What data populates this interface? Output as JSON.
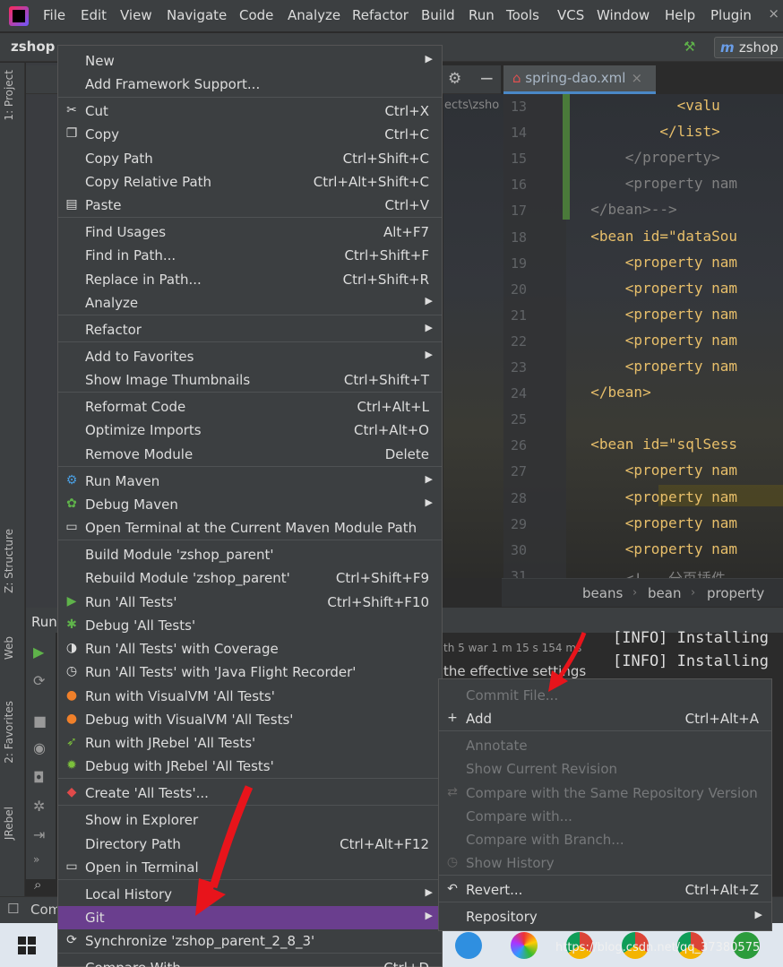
{
  "menubar": {
    "items": [
      "File",
      "Edit",
      "View",
      "Navigate",
      "Code",
      "Analyze",
      "Refactor",
      "Build",
      "Run",
      "Tools",
      "VCS",
      "Window",
      "Help",
      "Plugin"
    ],
    "close": "×"
  },
  "navbar": {
    "project": "zshop",
    "run_config": "zshop"
  },
  "left_stripe": {
    "tabs": [
      "1: Project",
      "Z: Structure",
      "Web",
      "2: Favorites",
      "JRebel"
    ]
  },
  "editor": {
    "tab_label": "spring-dao.xml",
    "tab_close": "×",
    "path_hint": "ects\\zsho",
    "lines": [
      {
        "n": "13",
        "text": "            <valu",
        "kind": "tag"
      },
      {
        "n": "14",
        "text": "          </list>",
        "kind": "tag"
      },
      {
        "n": "15",
        "text": "      </property>",
        "kind": "cm"
      },
      {
        "n": "16",
        "text": "      <property nam",
        "kind": "cm"
      },
      {
        "n": "17",
        "text": "  </bean>-->",
        "kind": "cm"
      },
      {
        "n": "18",
        "text": "  <bean id=\"dataSou",
        "kind": "tag"
      },
      {
        "n": "19",
        "text": "      <property nam",
        "kind": "tag"
      },
      {
        "n": "20",
        "text": "      <property nam",
        "kind": "tag"
      },
      {
        "n": "21",
        "text": "      <property nam",
        "kind": "tag"
      },
      {
        "n": "22",
        "text": "      <property nam",
        "kind": "tag"
      },
      {
        "n": "23",
        "text": "      <property nam",
        "kind": "tag"
      },
      {
        "n": "24",
        "text": "  </bean>",
        "kind": "tag"
      },
      {
        "n": "25",
        "text": "",
        "kind": "tag"
      },
      {
        "n": "26",
        "text": "  <bean id=\"sqlSess",
        "kind": "tag"
      },
      {
        "n": "27",
        "text": "      <property nam",
        "kind": "tag"
      },
      {
        "n": "28",
        "text": "      <property nam",
        "kind": "tag"
      },
      {
        "n": "29",
        "text": "      <property nam",
        "kind": "tag"
      },
      {
        "n": "30",
        "text": "      <property nam",
        "kind": "tag"
      },
      {
        "n": "31",
        "text": "      <!-- 分页插件",
        "kind": "cm"
      }
    ],
    "breadcrumbs": [
      "beans",
      "bean",
      "property"
    ]
  },
  "run_panel": {
    "label": "Run",
    "summary1": "th 5 war 1 m 15 s 154 ms",
    "summary2": "the effective settings",
    "console": [
      "[INFO] Installing",
      "[INFO] Installing"
    ]
  },
  "bottom": {
    "label": "Com"
  },
  "context_menu": {
    "items": [
      {
        "label": "New",
        "shortcut": "",
        "submenu": true,
        "icon": ""
      },
      {
        "label": "Add Framework Support...",
        "shortcut": "",
        "submenu": false,
        "icon": ""
      },
      {
        "label": "Cut",
        "shortcut": "Ctrl+X",
        "submenu": false,
        "icon": "scissors-icon"
      },
      {
        "label": "Copy",
        "shortcut": "Ctrl+C",
        "submenu": false,
        "icon": "copy-icon"
      },
      {
        "label": "Copy Path",
        "shortcut": "Ctrl+Shift+C",
        "submenu": false,
        "icon": ""
      },
      {
        "label": "Copy Relative Path",
        "shortcut": "Ctrl+Alt+Shift+C",
        "submenu": false,
        "icon": ""
      },
      {
        "label": "Paste",
        "shortcut": "Ctrl+V",
        "submenu": false,
        "icon": "paste-icon"
      },
      {
        "label": "Find Usages",
        "shortcut": "Alt+F7",
        "submenu": false,
        "icon": ""
      },
      {
        "label": "Find in Path...",
        "shortcut": "Ctrl+Shift+F",
        "submenu": false,
        "icon": ""
      },
      {
        "label": "Replace in Path...",
        "shortcut": "Ctrl+Shift+R",
        "submenu": false,
        "icon": ""
      },
      {
        "label": "Analyze",
        "shortcut": "",
        "submenu": true,
        "icon": ""
      },
      {
        "label": "Refactor",
        "shortcut": "",
        "submenu": true,
        "icon": ""
      },
      {
        "label": "Add to Favorites",
        "shortcut": "",
        "submenu": true,
        "icon": ""
      },
      {
        "label": "Show Image Thumbnails",
        "shortcut": "Ctrl+Shift+T",
        "submenu": false,
        "icon": ""
      },
      {
        "label": "Reformat Code",
        "shortcut": "Ctrl+Alt+L",
        "submenu": false,
        "icon": ""
      },
      {
        "label": "Optimize Imports",
        "shortcut": "Ctrl+Alt+O",
        "submenu": false,
        "icon": ""
      },
      {
        "label": "Remove Module",
        "shortcut": "Delete",
        "submenu": false,
        "icon": ""
      },
      {
        "label": "Run Maven",
        "shortcut": "",
        "submenu": true,
        "icon": "maven-gear-icon"
      },
      {
        "label": "Debug Maven",
        "shortcut": "",
        "submenu": true,
        "icon": "maven-debug-icon"
      },
      {
        "label": "Open Terminal at the Current Maven Module Path",
        "shortcut": "",
        "submenu": false,
        "icon": "terminal-icon"
      },
      {
        "label": "Build Module 'zshop_parent'",
        "shortcut": "",
        "submenu": false,
        "icon": ""
      },
      {
        "label": "Rebuild Module 'zshop_parent'",
        "shortcut": "Ctrl+Shift+F9",
        "submenu": false,
        "icon": ""
      },
      {
        "label": "Run 'All Tests'",
        "shortcut": "Ctrl+Shift+F10",
        "submenu": false,
        "icon": "run-triangle-icon"
      },
      {
        "label": "Debug 'All Tests'",
        "shortcut": "",
        "submenu": false,
        "icon": "debug-bug-icon"
      },
      {
        "label": "Run 'All Tests' with Coverage",
        "shortcut": "",
        "submenu": false,
        "icon": "coverage-icon"
      },
      {
        "label": "Run 'All Tests' with 'Java Flight Recorder'",
        "shortcut": "",
        "submenu": false,
        "icon": "flight-recorder-icon"
      },
      {
        "label": "Run with VisualVM 'All Tests'",
        "shortcut": "",
        "submenu": false,
        "icon": "visualvm-run-icon"
      },
      {
        "label": "Debug with VisualVM 'All Tests'",
        "shortcut": "",
        "submenu": false,
        "icon": "visualvm-debug-icon"
      },
      {
        "label": "Run with JRebel 'All Tests'",
        "shortcut": "",
        "submenu": false,
        "icon": "jrebel-run-icon"
      },
      {
        "label": "Debug with JRebel 'All Tests'",
        "shortcut": "",
        "submenu": false,
        "icon": "jrebel-debug-icon"
      },
      {
        "label": "Create 'All Tests'...",
        "shortcut": "",
        "submenu": false,
        "icon": "create-config-icon"
      },
      {
        "label": "Show in Explorer",
        "shortcut": "",
        "submenu": false,
        "icon": ""
      },
      {
        "label": "Directory Path",
        "shortcut": "Ctrl+Alt+F12",
        "submenu": false,
        "icon": ""
      },
      {
        "label": "Open in Terminal",
        "shortcut": "",
        "submenu": false,
        "icon": "terminal-icon"
      },
      {
        "label": "Local History",
        "shortcut": "",
        "submenu": true,
        "icon": ""
      },
      {
        "label": "Git",
        "shortcut": "",
        "submenu": true,
        "icon": ""
      },
      {
        "label": "Synchronize 'zshop_parent_2_8_3'",
        "shortcut": "",
        "submenu": false,
        "icon": "sync-icon"
      },
      {
        "label": "Compare With...",
        "shortcut": "Ctrl+D",
        "submenu": false,
        "icon": ""
      }
    ]
  },
  "git_submenu": {
    "items": [
      {
        "label": "Commit File...",
        "shortcut": "",
        "disabled": true,
        "icon": ""
      },
      {
        "label": "Add",
        "shortcut": "Ctrl+Alt+A",
        "disabled": false,
        "icon": "plus-icon"
      },
      {
        "label": "Annotate",
        "shortcut": "",
        "disabled": true,
        "icon": ""
      },
      {
        "label": "Show Current Revision",
        "shortcut": "",
        "disabled": true,
        "icon": ""
      },
      {
        "label": "Compare with the Same Repository Version",
        "shortcut": "",
        "disabled": true,
        "icon": "compare-icon"
      },
      {
        "label": "Compare with...",
        "shortcut": "",
        "disabled": true,
        "icon": ""
      },
      {
        "label": "Compare with Branch...",
        "shortcut": "",
        "disabled": true,
        "icon": ""
      },
      {
        "label": "Show History",
        "shortcut": "",
        "disabled": true,
        "icon": "clock-icon"
      },
      {
        "label": "Revert...",
        "shortcut": "Ctrl+Alt+Z",
        "disabled": false,
        "icon": "revert-icon"
      },
      {
        "label": "Repository",
        "shortcut": "",
        "disabled": false,
        "icon": ""
      }
    ]
  },
  "taskbar": {
    "watermark": "https://blog.csdn.net/qq_37380575"
  },
  "colors": {
    "selection": "#6a3e8e",
    "menu_bg": "#3c3f41",
    "arrow": "#e8141b"
  }
}
